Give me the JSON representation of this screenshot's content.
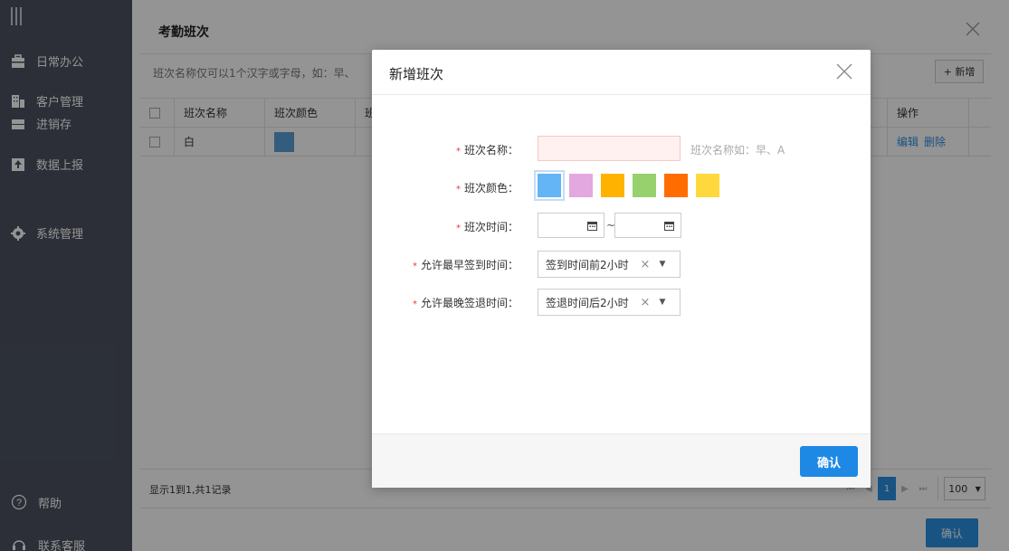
{
  "sidebar": {
    "items": [
      {
        "label": "日常办公",
        "icon": "briefcase-icon"
      },
      {
        "label": "客户管理",
        "icon": "building-icon"
      },
      {
        "label": "进销存",
        "icon": "inventory-icon"
      },
      {
        "label": "数据上报",
        "icon": "upload-icon"
      },
      {
        "label": "系统管理",
        "icon": "gear-icon"
      }
    ],
    "help_label": "帮助",
    "contact_label": "联系客服"
  },
  "backwin": {
    "title": "考勤班次",
    "hint": "班次名称仅可以1个汉字或字母，如：早、",
    "add_label": "+ 新增",
    "columns": [
      "班次名称",
      "班次颜色",
      "班",
      "操作"
    ],
    "rows": [
      {
        "name": "白",
        "color": "#5a9fd6",
        "edit": "编辑",
        "delete": "删除"
      }
    ],
    "footer_text": "显示1到1,共1记录",
    "page_size": "100",
    "confirm_label": "确认"
  },
  "modal": {
    "title": "新增班次",
    "name_label": "班次名称：",
    "name_tip": "班次名称如：早、A",
    "color_label": "班次颜色：",
    "colors": [
      "#64b5f6",
      "#e3a8e0",
      "#ffb300",
      "#96d16e",
      "#ff6d00",
      "#ffd83b"
    ],
    "time_label": "班次时间：",
    "time_sep": "~",
    "earliest_label": "允许最早签到时间：",
    "earliest_value": "签到时间前2小时",
    "latest_label": "允许最晚签退时间：",
    "latest_value": "签退时间后2小时",
    "confirm_label": "确认"
  }
}
